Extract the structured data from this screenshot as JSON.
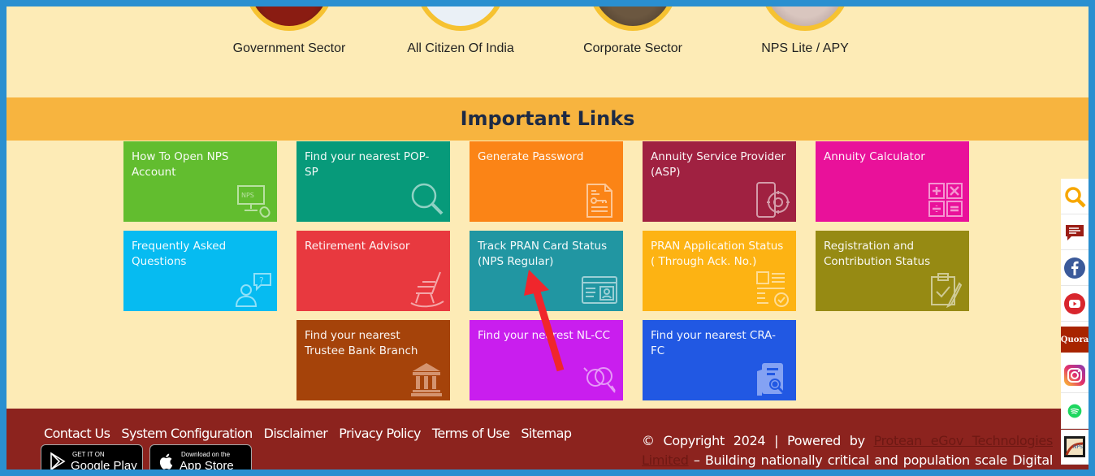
{
  "sectors": [
    {
      "label": "Government Sector"
    },
    {
      "label": "All Citizen Of India"
    },
    {
      "label": "Corporate Sector"
    },
    {
      "label": "NPS Lite / APY"
    }
  ],
  "section_title": "Important Links",
  "tiles": [
    {
      "label": "How To Open NPS Account",
      "color": "#62bd2f",
      "icon": "computer-mouse-icon"
    },
    {
      "label": "Find your nearest POP-SP",
      "color": "#079a7a",
      "icon": "magnifier-icon"
    },
    {
      "label": "Generate Password",
      "color": "#fb8416",
      "icon": "document-key-icon"
    },
    {
      "label": "Annuity Service Provider (ASP)",
      "color": "#a02141",
      "icon": "mobile-settings-icon"
    },
    {
      "label": "Annuity Calculator",
      "color": "#e9119a",
      "icon": "calculator-icon"
    },
    {
      "label": "Frequently Asked Questions",
      "color": "#06bbf1",
      "icon": "person-question-icon"
    },
    {
      "label": "Retirement Advisor",
      "color": "#e8393f",
      "icon": "rocking-chair-icon"
    },
    {
      "label": "Track PRAN Card Status (NPS Regular)",
      "color": "#2196a2",
      "icon": "id-card-browser-icon"
    },
    {
      "label": "PRAN Application Status ( Through Ack. No.)",
      "color": "#fdb313",
      "icon": "form-check-icon"
    },
    {
      "label": "Registration and Contribution Status",
      "color": "#968a13",
      "icon": "clipboard-check-icon"
    },
    {
      "label": "Find your nearest Trustee Bank Branch",
      "color": "#a5430a",
      "icon": "bank-building-icon"
    },
    {
      "label": "Find your nearest NL-CC",
      "color": "#c91eee",
      "icon": "search-sync-icon"
    },
    {
      "label": "Find your nearest CRA-FC",
      "color": "#2158e3",
      "icon": "folder-search-icon"
    }
  ],
  "footer": {
    "links": [
      "Contact Us",
      "System Configuration",
      "Disclaimer",
      "Privacy Policy",
      "Terms of Use",
      "Sitemap"
    ],
    "google_play": {
      "top": "GET IT ON",
      "main": "Google Play"
    },
    "app_store": {
      "top": "Download on the",
      "main": "App Store"
    },
    "copyright_prefix": "© Copyright 2024 | Powered by ",
    "company": "Protean eGov Technologies Limited",
    "copyright_suffix": " – Building nationally critical and population scale Digital"
  },
  "social": [
    {
      "name": "search"
    },
    {
      "name": "chat"
    },
    {
      "name": "facebook"
    },
    {
      "name": "youtube"
    },
    {
      "name": "quora",
      "text": "Quora"
    },
    {
      "name": "instagram"
    },
    {
      "name": "spotify"
    },
    {
      "name": "nps-app"
    }
  ],
  "annotation": {
    "type": "arrow",
    "color": "#f0262c",
    "target": "Track PRAN Card Status (NPS Regular)"
  }
}
